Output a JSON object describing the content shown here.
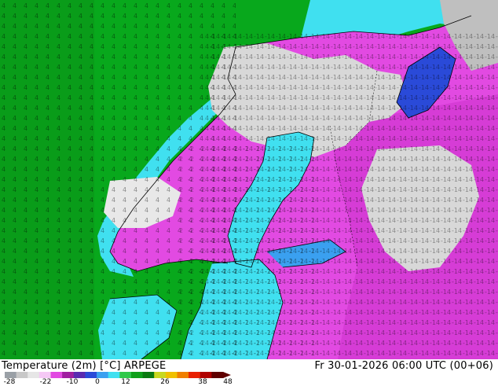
{
  "header": {
    "variable": "Temperature (2m) [°C]",
    "model": "ARPEGE",
    "valid_time": "Fr 30-01-2026 06:00 UTC (00+06)"
  },
  "legend": {
    "ticks": [
      "-28",
      "-22",
      "-10",
      "0",
      "12",
      "26",
      "38",
      "48"
    ],
    "colors": [
      "#9aa0a6",
      "#c8c8c8",
      "#e6e6e6",
      "#f5c8f5",
      "#e24ae2",
      "#a01ea0",
      "#5a2ab0",
      "#2a4ad8",
      "#3aa0f0",
      "#40e0f0",
      "#30c84a",
      "#0fa01a",
      "#0a7a10",
      "#c8d820",
      "#f0c000",
      "#f08000",
      "#e82000",
      "#b00000",
      "#600000"
    ]
  },
  "map_regions": [
    {
      "name": "north-atlantic",
      "fill": "#08a81c"
    },
    {
      "name": "norwegian-coast",
      "fill": "#40e0f0"
    },
    {
      "name": "scandinavian-mountains",
      "fill": "#e24ae2"
    },
    {
      "name": "gulf-of-bothnia",
      "fill": "#40e0f0"
    },
    {
      "name": "baltic-sea",
      "fill": "#40e0f0"
    },
    {
      "name": "finland-russia",
      "fill": "#d63cd6"
    },
    {
      "name": "cold-core",
      "fill": "#d8d8d8"
    }
  ]
}
